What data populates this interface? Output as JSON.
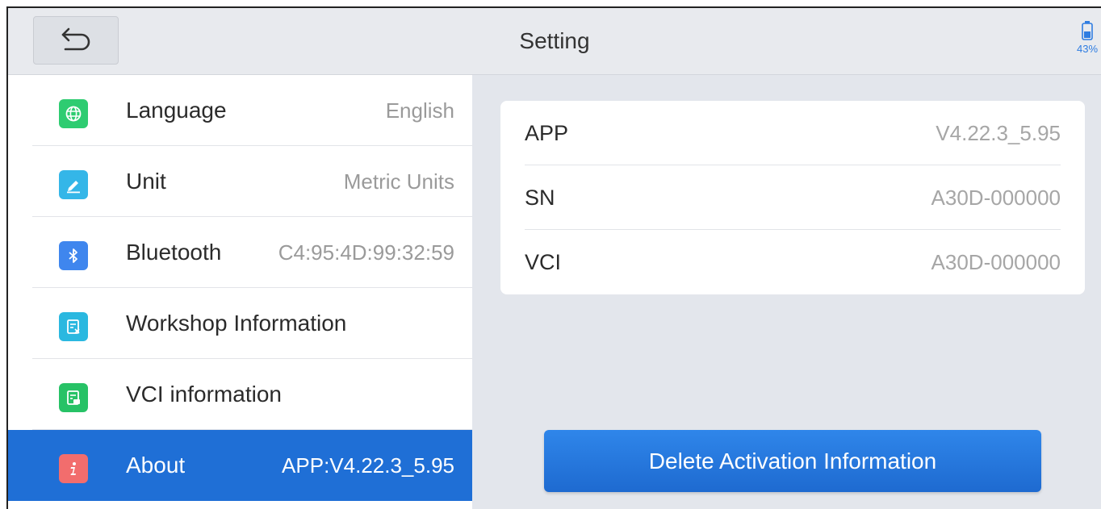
{
  "header": {
    "title": "Setting",
    "back_icon": "back-arrow-icon",
    "battery_percent": "43%",
    "battery_level": 0.43
  },
  "menu": {
    "items": [
      {
        "label": "Language",
        "value": "English",
        "icon": "globe-icon",
        "color": "#2ecc71"
      },
      {
        "label": "Unit",
        "value": "Metric Units",
        "icon": "ruler-pen-icon",
        "color": "#34b6e8"
      },
      {
        "label": "Bluetooth",
        "value": "C4:95:4D:99:32:59",
        "icon": "bluetooth-icon",
        "color": "#3f86ee"
      },
      {
        "label": "Workshop Information",
        "value": "",
        "icon": "document-edit-icon",
        "color": "#2ab8e0"
      },
      {
        "label": "VCI information",
        "value": "",
        "icon": "document-vci-icon",
        "color": "#27c266"
      },
      {
        "label": "About",
        "value": "APP:V4.22.3_5.95",
        "icon": "info-icon",
        "color": "#f26d6d",
        "active": true
      }
    ],
    "active_color": "#1f6fd6"
  },
  "about": {
    "rows": [
      {
        "key": "APP",
        "value": "V4.22.3_5.95"
      },
      {
        "key": "SN",
        "value": "A30D-000000"
      },
      {
        "key": "VCI",
        "value": "A30D-000000"
      }
    ],
    "delete_label": "Delete Activation Information"
  }
}
